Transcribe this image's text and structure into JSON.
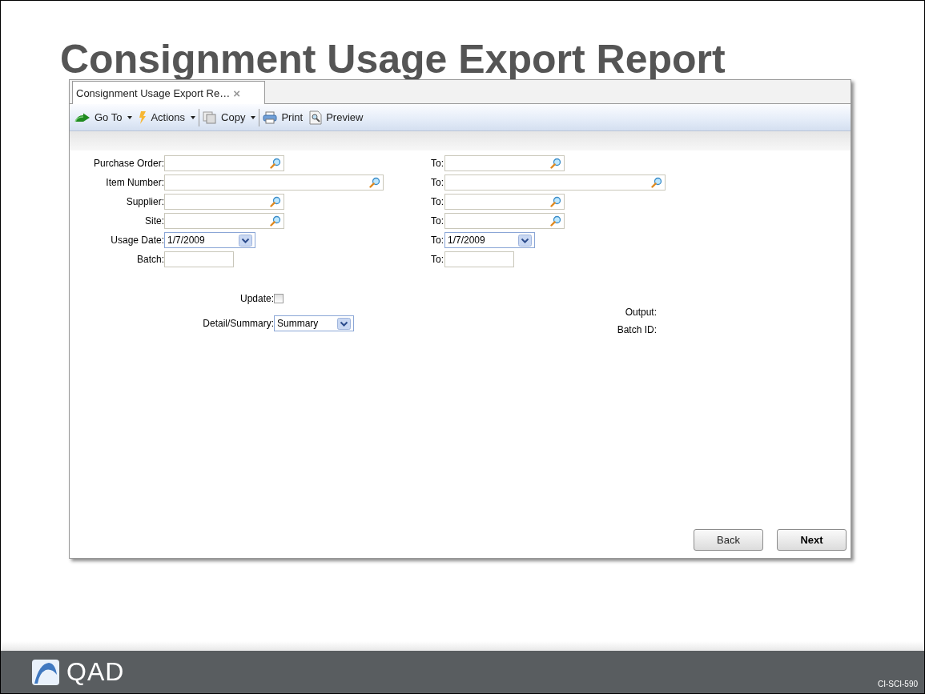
{
  "slide": {
    "title": "Consignment Usage Export Report"
  },
  "app": {
    "tab": {
      "label": "Consignment Usage Export Re…",
      "close": "×"
    },
    "toolbar": [
      {
        "label": "Go To",
        "kind": "menu"
      },
      {
        "label": "Actions",
        "kind": "menu"
      },
      {
        "label": "Copy",
        "kind": "menu"
      },
      {
        "label": "Print",
        "kind": "button"
      },
      {
        "label": "Preview",
        "kind": "button"
      }
    ],
    "rows": [
      {
        "label": "Purchase Order:",
        "from": {
          "kind": "lookup"
        },
        "to_label": "To:",
        "to": {
          "kind": "lookup"
        }
      },
      {
        "label": "Item Number:",
        "from": {
          "kind": "lookup"
        },
        "to_label": "To:",
        "to": {
          "kind": "lookup"
        }
      },
      {
        "label": "Supplier:",
        "from": {
          "kind": "lookup"
        },
        "to_label": "To:",
        "to": {
          "kind": "lookup"
        }
      },
      {
        "label": "Site:",
        "from": {
          "kind": "lookup"
        },
        "to_label": "To:",
        "to": {
          "kind": "lookup"
        }
      },
      {
        "label": "Usage Date:",
        "from": {
          "kind": "date",
          "value": "1/7/2009"
        },
        "to_label": "To:",
        "to": {
          "kind": "date",
          "value": "1/7/2009"
        }
      },
      {
        "label": "Batch:",
        "from": {
          "kind": "text"
        },
        "to_label": "To:",
        "to": {
          "kind": "text"
        }
      }
    ],
    "update": {
      "label": "Update:",
      "checked": false
    },
    "detail_summary": {
      "label": "Detail/Summary:",
      "value": "Summary"
    },
    "outputs": [
      "Output:",
      "Batch ID:"
    ],
    "buttons": [
      {
        "label": "Back",
        "primary": false
      },
      {
        "label": "Next",
        "primary": true
      }
    ]
  },
  "footer": {
    "logo": "QAD",
    "code": "CI-SCI-590"
  }
}
